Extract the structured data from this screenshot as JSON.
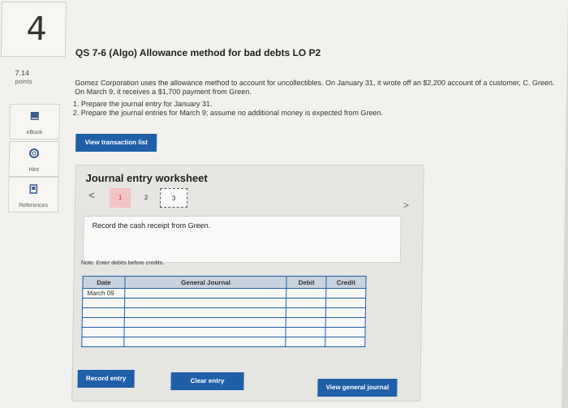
{
  "question": {
    "number": "4",
    "points_value": "7.14",
    "points_label": "points",
    "title": "QS 7-6 (Algo) Allowance method for bad debts LO P2",
    "paragraph": "Gomez Corporation uses the allowance method to account for uncollectibles. On January 31, it wrote off an $2,200 account of a customer, C. Green. On March 9, it receives a $1,700 payment from Green.",
    "step1": "1. Prepare the journal entry for January 31.",
    "step2": "2. Prepare the journal entries for March 9; assume no additional money is expected from Green."
  },
  "rail": {
    "ebook_label": "eBook",
    "hint_label": "Hint",
    "references_label": "References"
  },
  "buttons": {
    "view_transaction_list": "View transaction list",
    "record_entry": "Record entry",
    "clear_entry": "Clear entry",
    "view_general_journal": "View general journal"
  },
  "worksheet": {
    "title": "Journal entry worksheet",
    "prev_arrow": "<",
    "next_arrow": ">",
    "pages": [
      "1",
      "2",
      "3"
    ],
    "instruction": "Record the cash receipt from Green.",
    "note": "Note: Enter debits before credits.",
    "columns": [
      "Date",
      "General Journal",
      "Debit",
      "Credit"
    ],
    "rows": [
      [
        "March 09",
        "",
        "",
        ""
      ],
      [
        "",
        "",
        "",
        ""
      ],
      [
        "",
        "",
        "",
        ""
      ],
      [
        "",
        "",
        "",
        ""
      ],
      [
        "",
        "",
        "",
        ""
      ],
      [
        "",
        "",
        "",
        ""
      ]
    ]
  },
  "colors": {
    "accent": "#1f5fa8",
    "active_page": "#f2c4c4"
  }
}
